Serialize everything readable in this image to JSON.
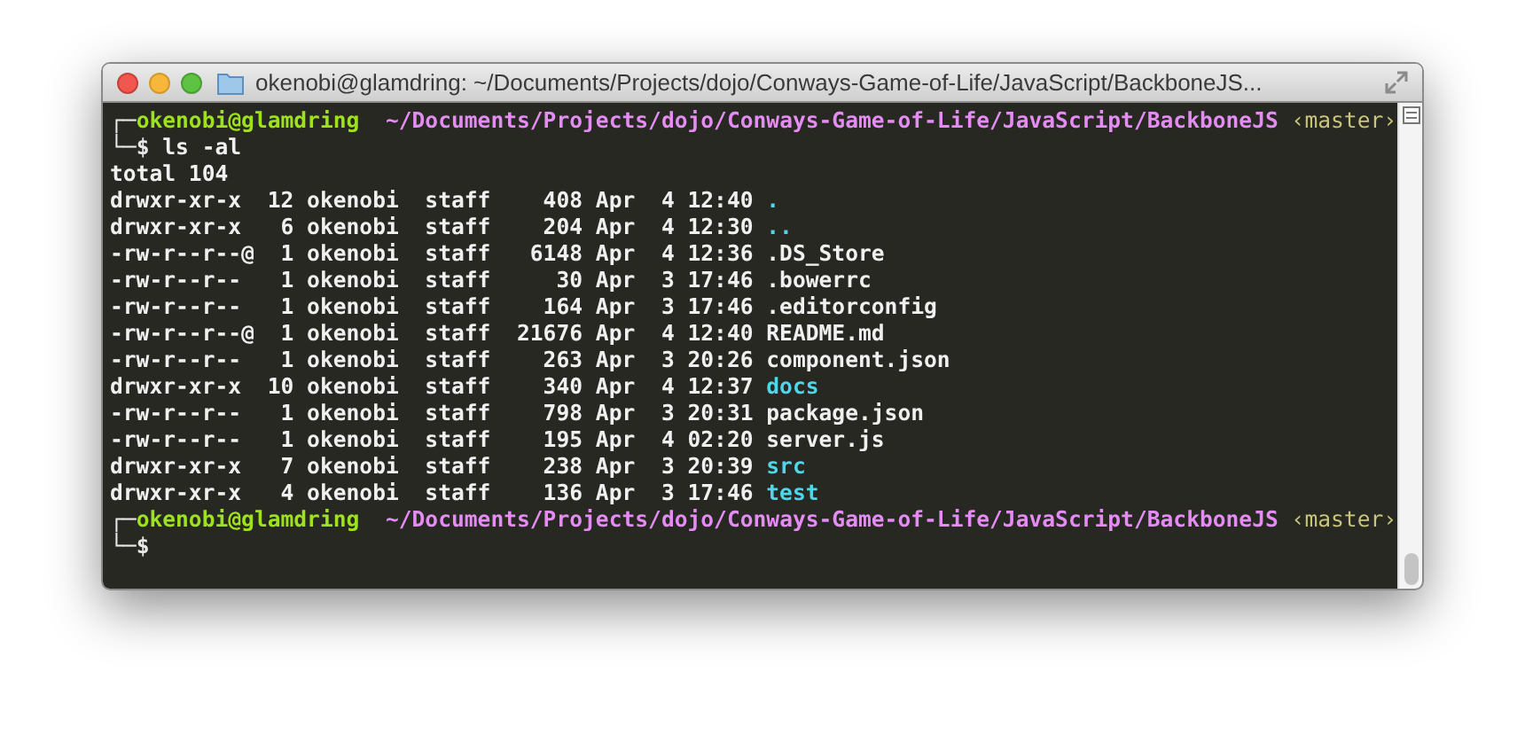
{
  "window": {
    "title": "okenobi@glamdring: ~/Documents/Projects/dojo/Conways-Game-of-Life/JavaScript/BackboneJS..."
  },
  "lines": [
    {
      "kind": "prompt-top",
      "corner": "┌─",
      "user": "okenobi@glamdring",
      "path": "~/Documents/Projects/dojo/Conways-Game-of-Life/JavaScript/BackboneJS",
      "branch": "‹master›"
    },
    {
      "kind": "prompt-bottom",
      "corner": "└─",
      "symbol": "$",
      "command": "ls -al"
    },
    {
      "kind": "output",
      "text": "total 104"
    },
    {
      "kind": "entry",
      "text": "drwxr-xr-x  12 okenobi  staff    408 Apr  4 12:40",
      "name": ".",
      "is_dir": true
    },
    {
      "kind": "entry",
      "text": "drwxr-xr-x   6 okenobi  staff    204 Apr  4 12:30",
      "name": "..",
      "is_dir": true
    },
    {
      "kind": "entry",
      "text": "-rw-r--r--@  1 okenobi  staff   6148 Apr  4 12:36",
      "name": ".DS_Store",
      "is_dir": false
    },
    {
      "kind": "entry",
      "text": "-rw-r--r--   1 okenobi  staff     30 Apr  3 17:46",
      "name": ".bowerrc",
      "is_dir": false
    },
    {
      "kind": "entry",
      "text": "-rw-r--r--   1 okenobi  staff    164 Apr  3 17:46",
      "name": ".editorconfig",
      "is_dir": false
    },
    {
      "kind": "entry",
      "text": "-rw-r--r--@  1 okenobi  staff  21676 Apr  4 12:40",
      "name": "README.md",
      "is_dir": false
    },
    {
      "kind": "entry",
      "text": "-rw-r--r--   1 okenobi  staff    263 Apr  3 20:26",
      "name": "component.json",
      "is_dir": false
    },
    {
      "kind": "entry",
      "text": "drwxr-xr-x  10 okenobi  staff    340 Apr  4 12:37",
      "name": "docs",
      "is_dir": true
    },
    {
      "kind": "entry",
      "text": "-rw-r--r--   1 okenobi  staff    798 Apr  3 20:31",
      "name": "package.json",
      "is_dir": false
    },
    {
      "kind": "entry",
      "text": "-rw-r--r--   1 okenobi  staff    195 Apr  4 02:20",
      "name": "server.js",
      "is_dir": false
    },
    {
      "kind": "entry",
      "text": "drwxr-xr-x   7 okenobi  staff    238 Apr  3 20:39",
      "name": "src",
      "is_dir": true
    },
    {
      "kind": "entry",
      "text": "drwxr-xr-x   4 okenobi  staff    136 Apr  3 17:46",
      "name": "test",
      "is_dir": true
    },
    {
      "kind": "prompt-top",
      "corner": "┌─",
      "user": "okenobi@glamdring",
      "path": "~/Documents/Projects/dojo/Conways-Game-of-Life/JavaScript/BackboneJS",
      "branch": "‹master›"
    },
    {
      "kind": "prompt-bottom",
      "corner": "└─",
      "symbol": "$"
    }
  ]
}
